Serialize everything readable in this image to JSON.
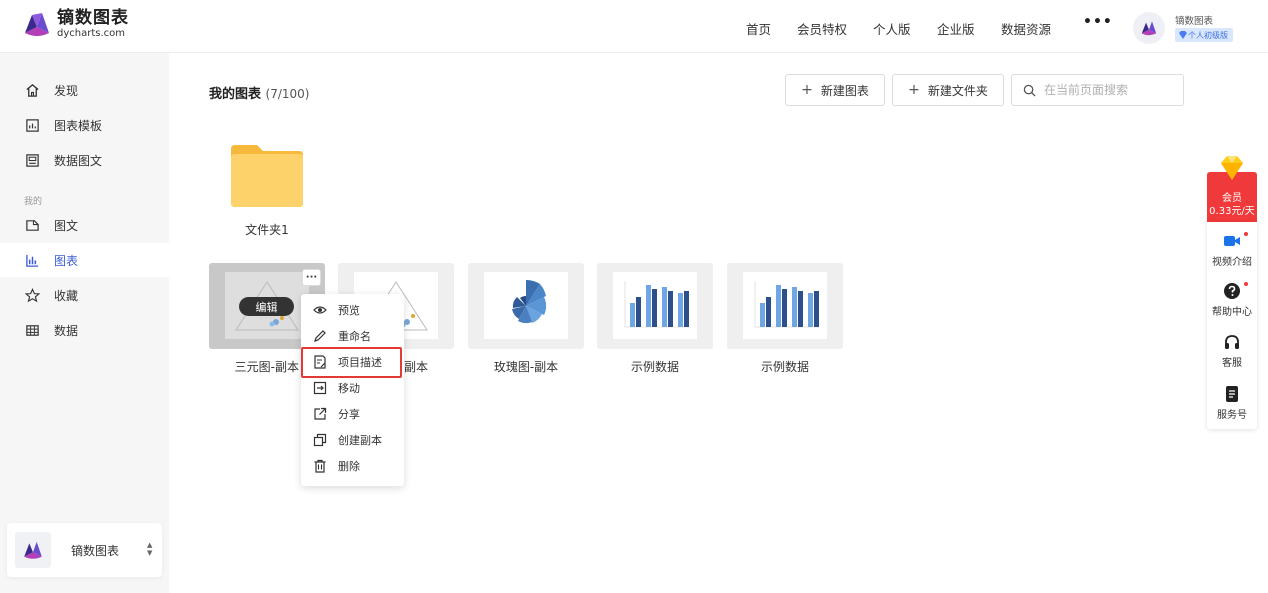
{
  "brand": {
    "name_cn": "镝数图表",
    "name_en": "dycharts.com"
  },
  "nav": {
    "items": [
      "首页",
      "会员特权",
      "个人版",
      "企业版",
      "数据资源"
    ],
    "more": "•••"
  },
  "user": {
    "name": "镝数图表",
    "badge": "个人初级版"
  },
  "sidebar": {
    "items": [
      {
        "label": "发现",
        "icon": "home-icon"
      },
      {
        "label": "图表模板",
        "icon": "chart-template-icon"
      },
      {
        "label": "数据图文",
        "icon": "data-article-icon"
      }
    ],
    "group_label": "我的",
    "my_items": [
      {
        "label": "图文",
        "icon": "article-icon"
      },
      {
        "label": "图表",
        "icon": "bar-chart-icon",
        "active": true
      },
      {
        "label": "收藏",
        "icon": "star-icon"
      },
      {
        "label": "数据",
        "icon": "table-icon"
      }
    ],
    "account": {
      "name": "镝数图表"
    }
  },
  "main": {
    "title": "我的图表",
    "count": "(7/100)",
    "new_chart_label": "新建图表",
    "new_folder_label": "新建文件夹",
    "search_placeholder": "在当前页面搜索",
    "folder": {
      "label": "文件夹1"
    },
    "cards": [
      {
        "label": "三元图-副本",
        "icon": "ternary-chart-thumbnail"
      },
      {
        "label": "副本",
        "icon": "ternary-chart-thumbnail"
      },
      {
        "label": "玫瑰图-副本",
        "icon": "rose-chart-thumbnail"
      },
      {
        "label": "示例数据",
        "icon": "bar-chart-thumbnail"
      },
      {
        "label": "示例数据",
        "icon": "bar-chart-thumbnail"
      }
    ],
    "edit_label": "编辑",
    "more_label": "···"
  },
  "context_menu": {
    "items": [
      {
        "label": "预览",
        "icon": "eye-icon"
      },
      {
        "label": "重命名",
        "icon": "pencil-icon"
      },
      {
        "label": "项目描述",
        "icon": "edit-doc-icon",
        "highlighted": true
      },
      {
        "label": "移动",
        "icon": "move-icon"
      },
      {
        "label": "分享",
        "icon": "share-icon"
      },
      {
        "label": "创建副本",
        "icon": "copy-icon"
      },
      {
        "label": "删除",
        "icon": "trash-icon"
      }
    ]
  },
  "right_bar": {
    "vip_label": "会员",
    "vip_price": "0.33元/天",
    "items": [
      {
        "label": "视频介绍",
        "icon": "video-icon"
      },
      {
        "label": "帮助中心",
        "icon": "help-icon"
      },
      {
        "label": "客服",
        "icon": "headset-icon"
      },
      {
        "label": "服务号",
        "icon": "service-account-icon"
      }
    ]
  },
  "colors": {
    "accent": "#3b5cd6",
    "highlight_border": "#e53935",
    "vip_red": "#f0393a",
    "folder_yellow": "#fbc44a"
  }
}
